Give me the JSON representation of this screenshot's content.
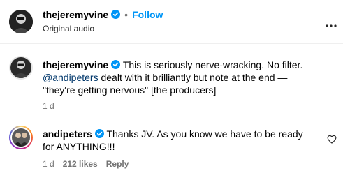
{
  "header": {
    "username": "thejeremyvine",
    "separator": "•",
    "follow_label": "Follow",
    "subtitle": "Original audio",
    "more_icon": "more-horizontal-icon"
  },
  "comments": [
    {
      "username": "thejeremyvine",
      "verified": true,
      "line1": "This is seriously nerve-wracking. No filter.",
      "mention": "@andipeters",
      "line2_rest": " dealt with it brilliantly but note at the end —",
      "line3": "\"they're getting nervous\" [the producers]",
      "time": "1 d"
    },
    {
      "username": "andipeters",
      "verified": true,
      "line1": "Thanks JV. As you know we have to be ready",
      "line2": "for ANYTHING!!!",
      "time": "1 d",
      "likes": "212 likes",
      "reply_label": "Reply",
      "like_icon": "heart-outline-icon"
    }
  ],
  "colors": {
    "accent": "#0095f6",
    "verified": "#0095f6",
    "mention": "#00376b",
    "meta": "#737373"
  }
}
